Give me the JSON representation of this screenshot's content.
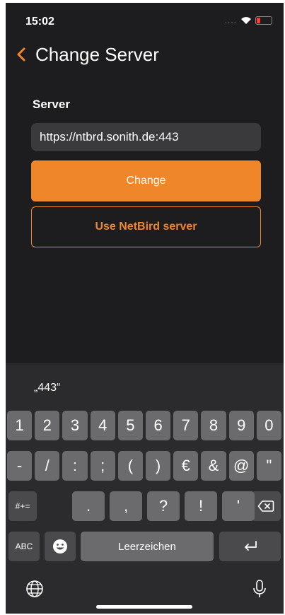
{
  "status_bar": {
    "time": "15:02",
    "signal": "...."
  },
  "nav": {
    "title": "Change Server"
  },
  "form": {
    "label": "Server",
    "input_value": "https://ntbrd.sonith.de:443",
    "primary_button": "Change",
    "secondary_button": "Use NetBird server"
  },
  "keyboard": {
    "suggestion": "„443“",
    "row1": [
      "1",
      "2",
      "3",
      "4",
      "5",
      "6",
      "7",
      "8",
      "9",
      "0"
    ],
    "row2": [
      "-",
      "/",
      ":",
      ";",
      "(",
      ")",
      "€",
      "&",
      "@",
      "\""
    ],
    "row3_mode": "#+=",
    "row3": [
      ".",
      ",",
      "?",
      "!",
      "'"
    ],
    "abc": "ABC",
    "space": "Leerzeichen"
  },
  "colors": {
    "accent": "#f0862a",
    "background": "#1d1d1f",
    "key": "#6b6b6d",
    "key_dark": "#4a4a4c"
  }
}
